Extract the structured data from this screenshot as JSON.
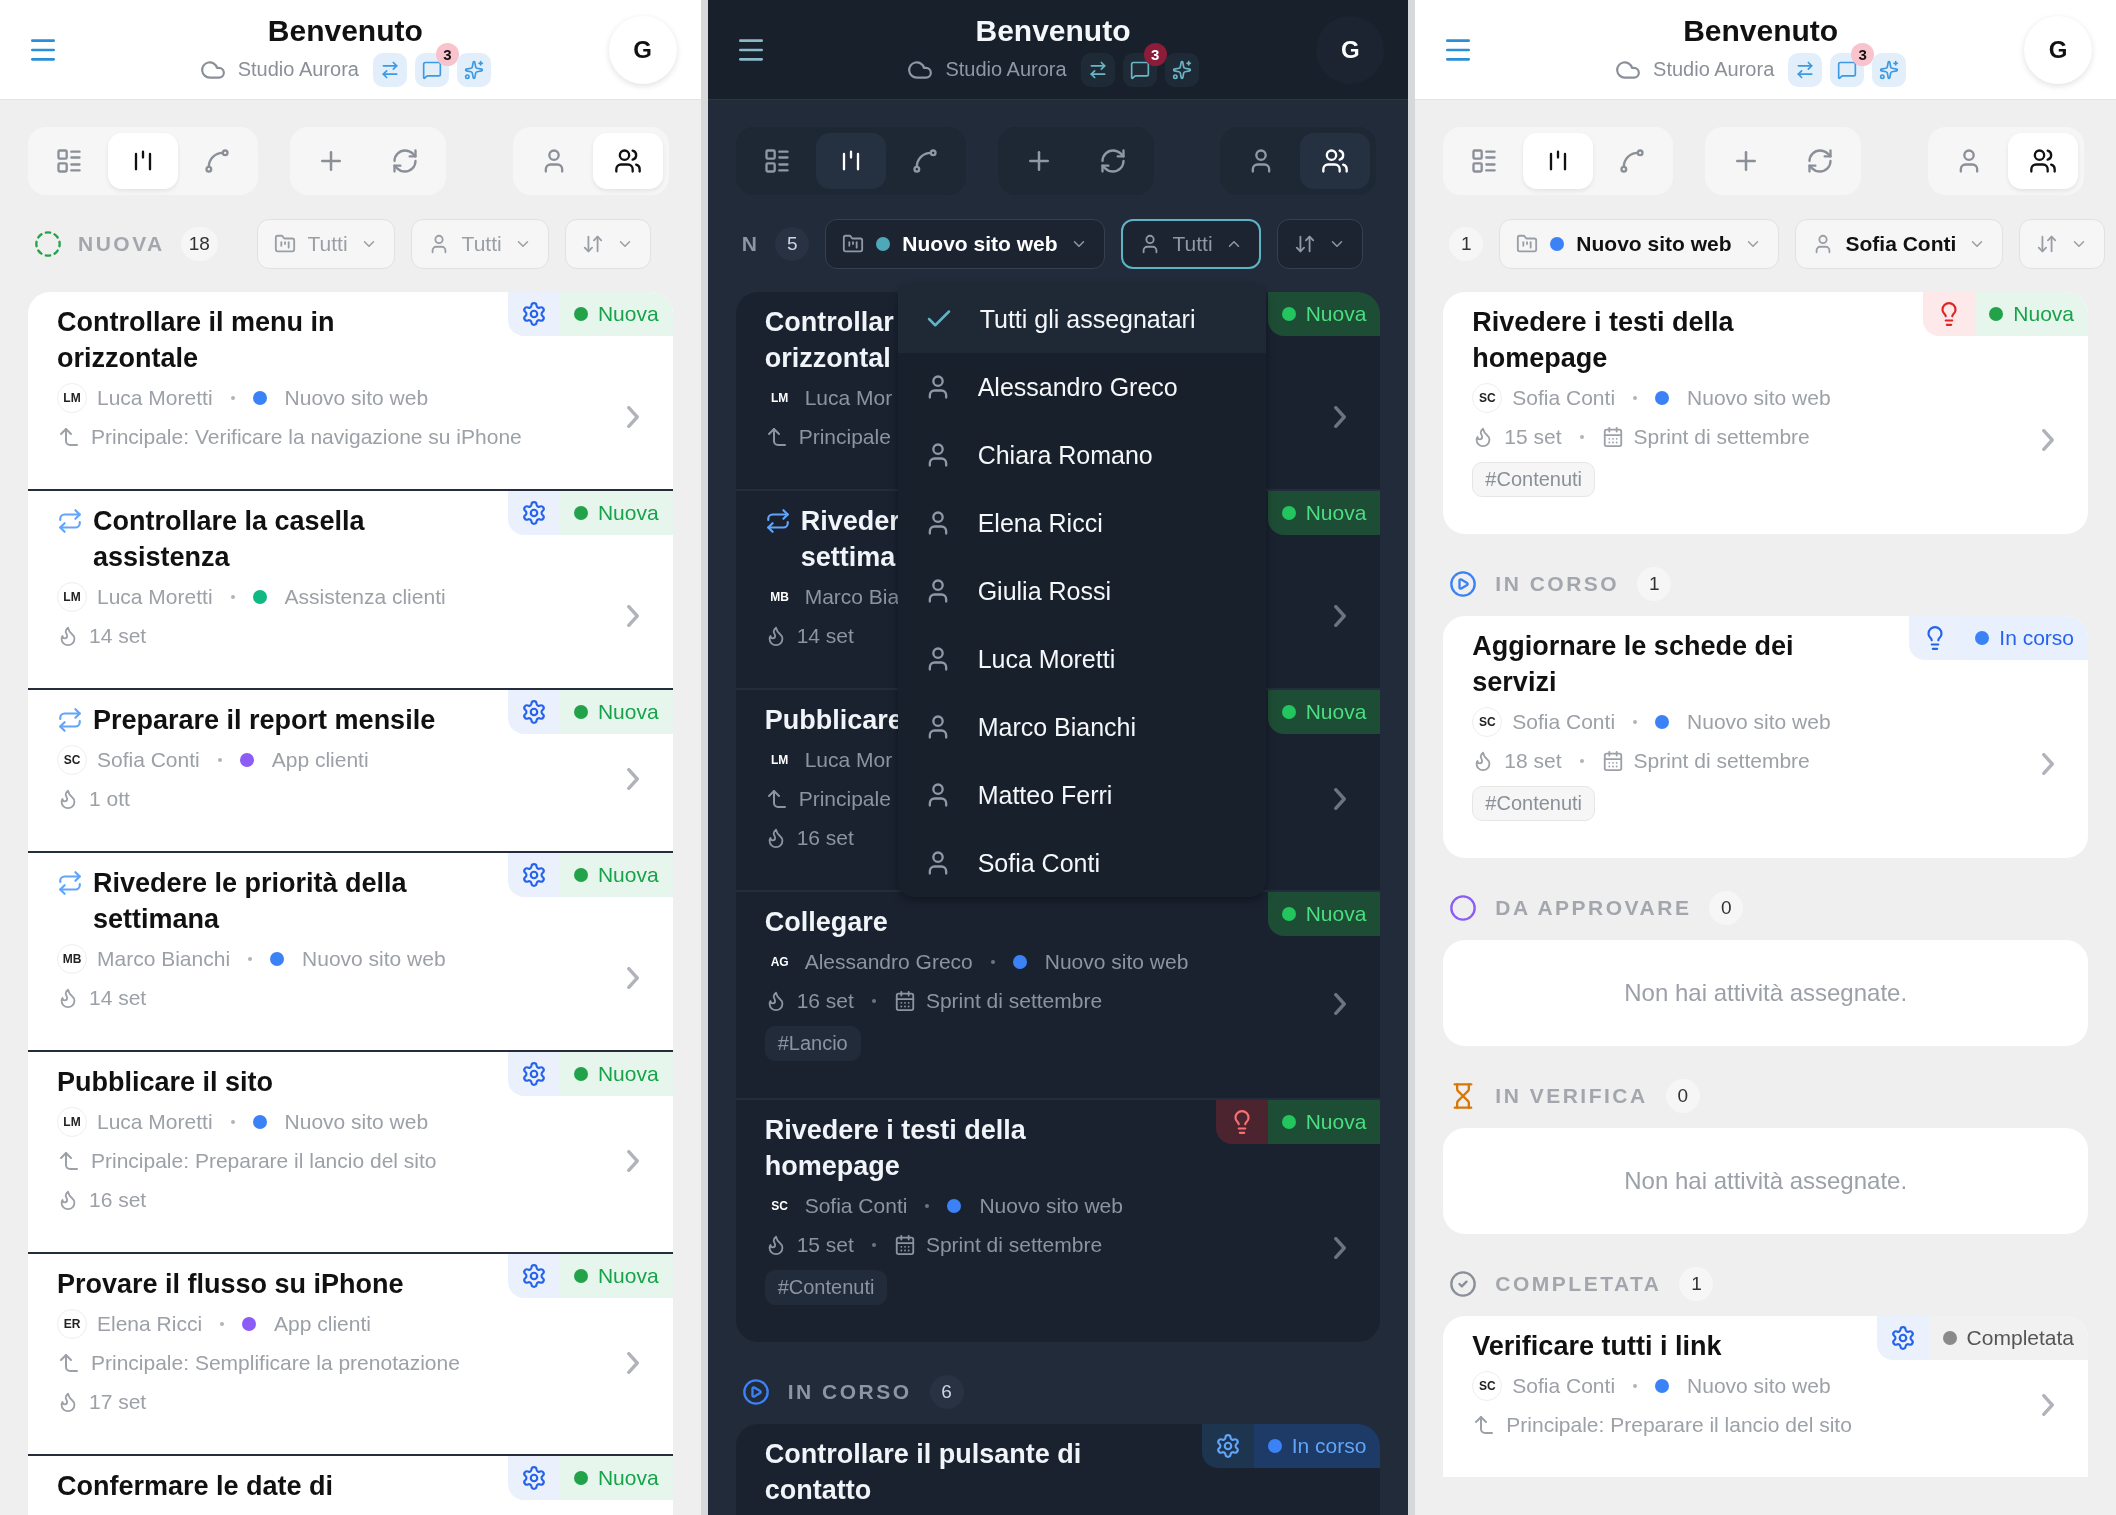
{
  "panels": [
    {
      "kind": "light",
      "header": {
        "title": "Benvenuto",
        "workspace": "Studio Aurora",
        "notification_count": "3",
        "avatar": "G"
      },
      "toolbar": {
        "views": [
          {
            "kind": "list",
            "selected": false
          },
          {
            "kind": "board",
            "selected": true
          },
          {
            "kind": "flow",
            "selected": false
          }
        ],
        "scopes": [
          {
            "kind": "me",
            "selected": false
          },
          {
            "kind": "team",
            "selected": true
          }
        ]
      },
      "filters": {
        "leading": {
          "kind": "new",
          "label": "NUOVA",
          "count": "18"
        },
        "project": {
          "label": "Tutti",
          "active": false
        },
        "assignee": {
          "label": "Tutti",
          "active": false,
          "expanded": false
        }
      },
      "sections": [
        {
          "tasks": [
            {
              "title": "Controllare il menu in orizzontale",
              "assignee": {
                "initials": "LM",
                "name": "Luca Moretti"
              },
              "project": {
                "name": "Nuovo sito web",
                "color": "#3b82f6"
              },
              "parent": "Principale: Verificare la navigazione su iPhone",
              "badge": {
                "kind": "settings"
              },
              "status": {
                "kind": "new",
                "label": "Nuova"
              }
            },
            {
              "title": "Controllare la casella assistenza",
              "recurring": true,
              "assignee": {
                "initials": "LM",
                "name": "Luca Moretti"
              },
              "project": {
                "name": "Assistenza clienti",
                "color": "#10b981"
              },
              "due": "14 set",
              "badge": {
                "kind": "settings"
              },
              "status": {
                "kind": "new",
                "label": "Nuova"
              }
            },
            {
              "title": "Preparare il report mensile",
              "recurring": true,
              "assignee": {
                "initials": "SC",
                "name": "Sofia Conti"
              },
              "project": {
                "name": "App clienti",
                "color": "#8b5cf6"
              },
              "due": "1 ott",
              "badge": {
                "kind": "settings"
              },
              "status": {
                "kind": "new",
                "label": "Nuova"
              }
            },
            {
              "title": "Rivedere le priorità della settimana",
              "recurring": true,
              "assignee": {
                "initials": "MB",
                "name": "Marco Bianchi"
              },
              "project": {
                "name": "Nuovo sito web",
                "color": "#3b82f6"
              },
              "due": "14 set",
              "badge": {
                "kind": "settings"
              },
              "status": {
                "kind": "new",
                "label": "Nuova"
              }
            },
            {
              "title": "Pubblicare il sito",
              "assignee": {
                "initials": "LM",
                "name": "Luca Moretti"
              },
              "project": {
                "name": "Nuovo sito web",
                "color": "#3b82f6"
              },
              "parent": "Principale: Preparare il lancio del sito",
              "due": "16 set",
              "badge": {
                "kind": "settings"
              },
              "status": {
                "kind": "new",
                "label": "Nuova"
              }
            },
            {
              "title": "Provare il flusso su iPhone",
              "assignee": {
                "initials": "ER",
                "name": "Elena Ricci"
              },
              "project": {
                "name": "App clienti",
                "color": "#8b5cf6"
              },
              "parent": "Principale: Semplificare la prenotazione",
              "due": "17 set",
              "badge": {
                "kind": "settings"
              },
              "status": {
                "kind": "new",
                "label": "Nuova"
              }
            },
            {
              "title": "Confermare le date di",
              "badge": {
                "kind": "settings"
              },
              "status": {
                "kind": "new",
                "label": "Nuova"
              }
            }
          ]
        }
      ]
    },
    {
      "kind": "dark",
      "header": {
        "title": "Benvenuto",
        "workspace": "Studio Aurora",
        "notification_count": "3",
        "avatar": "G"
      },
      "toolbar": {
        "views": [
          {
            "kind": "list",
            "selected": false
          },
          {
            "kind": "board",
            "selected": true
          },
          {
            "kind": "flow",
            "selected": false
          }
        ],
        "scopes": [
          {
            "kind": "me",
            "selected": false
          },
          {
            "kind": "team",
            "selected": true
          }
        ]
      },
      "filters": {
        "leading": {
          "label": "N",
          "count": "5"
        },
        "project": {
          "label": "Nuovo sito web",
          "color": "#4fa8b8",
          "active": true
        },
        "assignee": {
          "label": "Tutti",
          "active": false,
          "expanded": true,
          "menu": [
            {
              "label": "Tutti gli assegnatari",
              "selected": true
            },
            {
              "label": "Alessandro Greco",
              "selected": false
            },
            {
              "label": "Chiara Romano",
              "selected": false
            },
            {
              "label": "Elena Ricci",
              "selected": false
            },
            {
              "label": "Giulia Rossi",
              "selected": false
            },
            {
              "label": "Luca Moretti",
              "selected": false
            },
            {
              "label": "Marco Bianchi",
              "selected": false
            },
            {
              "label": "Matteo Ferri",
              "selected": false
            },
            {
              "label": "Sofia Conti",
              "selected": false
            }
          ]
        }
      },
      "sections": [
        {
          "tasks": [
            {
              "title": "Controllar\norizzontal",
              "assignee": {
                "initials": "LM",
                "name": "Luca Mor"
              },
              "parent": "Principale",
              "status": {
                "kind": "new",
                "label": "Nuova"
              }
            },
            {
              "title": "Riveder\nsettima",
              "recurring": true,
              "assignee": {
                "initials": "MB",
                "name": "Marco Bia"
              },
              "due": "14 set",
              "status": {
                "kind": "new",
                "label": "Nuova"
              }
            },
            {
              "title": "Pubblicare",
              "assignee": {
                "initials": "LM",
                "name": "Luca Mor"
              },
              "parent": "Principale",
              "due": "16 set",
              "status": {
                "kind": "new",
                "label": "Nuova"
              }
            },
            {
              "title": "Collegare",
              "assignee": {
                "initials": "AG",
                "name": "Alessandro Greco"
              },
              "project": {
                "name": "Nuovo sito web",
                "color": "#3b82f6"
              },
              "due": "16 set",
              "sprint": "Sprint di settembre",
              "tag": "#Lancio",
              "status": {
                "kind": "new",
                "label": "Nuova"
              }
            },
            {
              "title": "Rivedere i testi della homepage",
              "assignee": {
                "initials": "SC",
                "name": "Sofia Conti"
              },
              "project": {
                "name": "Nuovo sito web",
                "color": "#3b82f6"
              },
              "due": "15 set",
              "sprint": "Sprint di settembre",
              "tag": "#Contenuti",
              "badge": {
                "kind": "priority"
              },
              "status": {
                "kind": "new",
                "label": "Nuova"
              }
            }
          ]
        },
        {
          "kind": "in_progress",
          "label": "IN CORSO",
          "count": "6",
          "tasks": [
            {
              "title": "Controllare il pulsante di contatto",
              "badge": {
                "kind": "settings"
              },
              "status": {
                "kind": "in_progress",
                "label": "In corso"
              }
            }
          ]
        }
      ]
    },
    {
      "kind": "light",
      "header": {
        "title": "Benvenuto",
        "workspace": "Studio Aurora",
        "notification_count": "3",
        "avatar": "G"
      },
      "toolbar": {
        "views": [
          {
            "kind": "list",
            "selected": false
          },
          {
            "kind": "board",
            "selected": true
          },
          {
            "kind": "flow",
            "selected": false
          }
        ],
        "scopes": [
          {
            "kind": "me",
            "selected": false
          },
          {
            "kind": "team",
            "selected": true
          }
        ]
      },
      "filters": {
        "leading": {
          "count": "1"
        },
        "project": {
          "label": "Nuovo sito web",
          "color": "#3b82f6",
          "active": true
        },
        "assignee": {
          "label": "Sofia Conti",
          "active": true,
          "expanded": false
        }
      },
      "sections": [
        {
          "tasks": [
            {
              "title": "Rivedere i testi della homepage",
              "assignee": {
                "initials": "SC",
                "name": "Sofia Conti"
              },
              "project": {
                "name": "Nuovo sito web",
                "color": "#3b82f6"
              },
              "due": "15 set",
              "sprint": "Sprint di settembre",
              "tag": "#Contenuti",
              "badge": {
                "kind": "priority"
              },
              "status": {
                "kind": "new",
                "label": "Nuova"
              }
            }
          ]
        },
        {
          "kind": "in_progress",
          "label": "IN CORSO",
          "count": "1",
          "tasks": [
            {
              "title": "Aggiornare le schede dei servizi",
              "assignee": {
                "initials": "SC",
                "name": "Sofia Conti"
              },
              "project": {
                "name": "Nuovo sito web",
                "color": "#3b82f6"
              },
              "due": "18 set",
              "sprint": "Sprint di settembre",
              "tag": "#Contenuti",
              "badge": {
                "kind": "idea"
              },
              "status": {
                "kind": "in_progress",
                "label": "In corso"
              }
            }
          ]
        },
        {
          "kind": "approval",
          "label": "DA APPROVARE",
          "count": "0",
          "empty": "Non hai attività assegnate."
        },
        {
          "kind": "review",
          "label": "IN VERIFICA",
          "count": "0",
          "empty": "Non hai attività assegnate."
        },
        {
          "kind": "done",
          "label": "COMPLETATA",
          "count": "1",
          "tasks": [
            {
              "title": "Verificare tutti i link",
              "assignee": {
                "initials": "SC",
                "name": "Sofia Conti"
              },
              "project": {
                "name": "Nuovo sito web",
                "color": "#3b82f6"
              },
              "parent": "Principale: Preparare il lancio del sito",
              "badge": {
                "kind": "settings"
              },
              "status": {
                "kind": "done",
                "label": "Completata"
              }
            }
          ]
        }
      ]
    }
  ]
}
